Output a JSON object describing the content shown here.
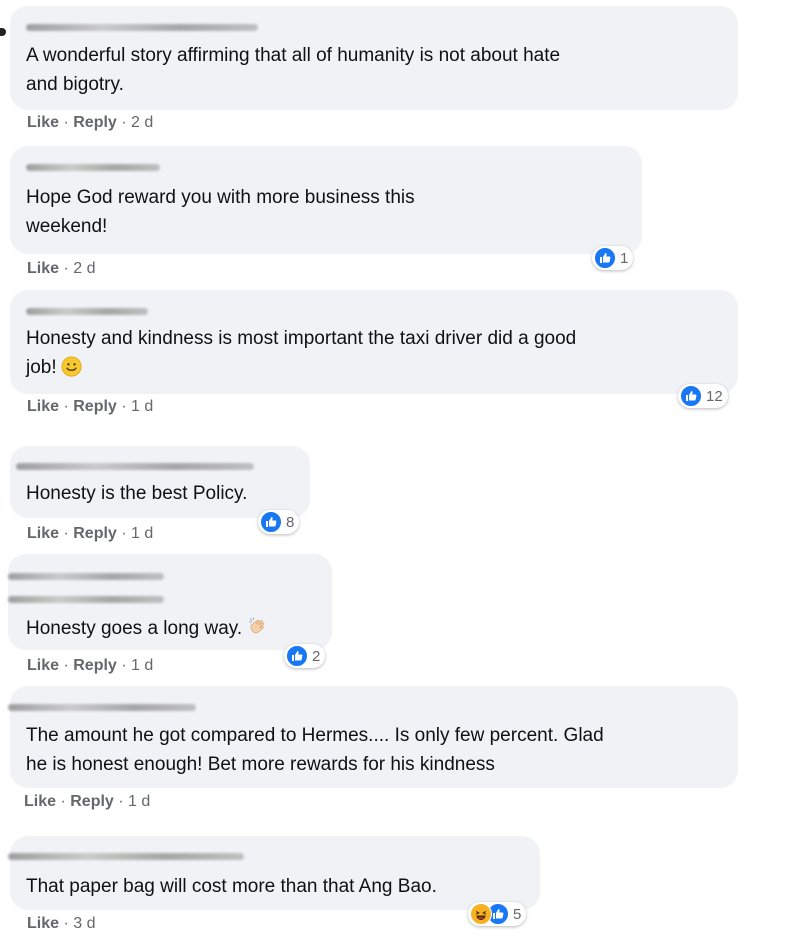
{
  "comments": [
    {
      "text": "A wonderful story affirming that all of humanity is not about hate\nand bigotry.",
      "like": "Like",
      "reply": "Reply",
      "time": "2 d",
      "reactions": ""
    },
    {
      "text": "Hope God reward you with more business this\nweekend!",
      "like": "Like",
      "reply": "",
      "time": "2 d",
      "reactions": "1"
    },
    {
      "text": "Honesty and kindness is most important the taxi driver did a good\njob!",
      "like": "Like",
      "reply": "Reply",
      "time": "1 d",
      "reactions": "12"
    },
    {
      "text": "Honesty is the best Policy.",
      "like": "Like",
      "reply": "Reply",
      "time": "1 d",
      "reactions": "8"
    },
    {
      "text": "Honesty goes a long way.",
      "like": "Like",
      "reply": "Reply",
      "time": "1 d",
      "reactions": "2"
    },
    {
      "text": "The amount he got compared to Hermes.... Is only few percent. Glad\nhe is honest enough! Bet more rewards for his kindness",
      "like": "Like",
      "reply": "Reply",
      "time": "1 d",
      "reactions": ""
    },
    {
      "text": "That paper bag will cost more than that Ang Bao.",
      "like": "Like",
      "reply": "",
      "time": "3 d",
      "reactions": "5"
    }
  ],
  "separator": " · ",
  "icons": {
    "like": "like-icon",
    "haha": "haha-icon",
    "smile": "smiling-face-emoji",
    "clap": "clapping-hands-emoji"
  },
  "colors": {
    "bubble": "#f0f2f5",
    "like_blue": "#1877f2",
    "meta_gray": "#65676b"
  }
}
